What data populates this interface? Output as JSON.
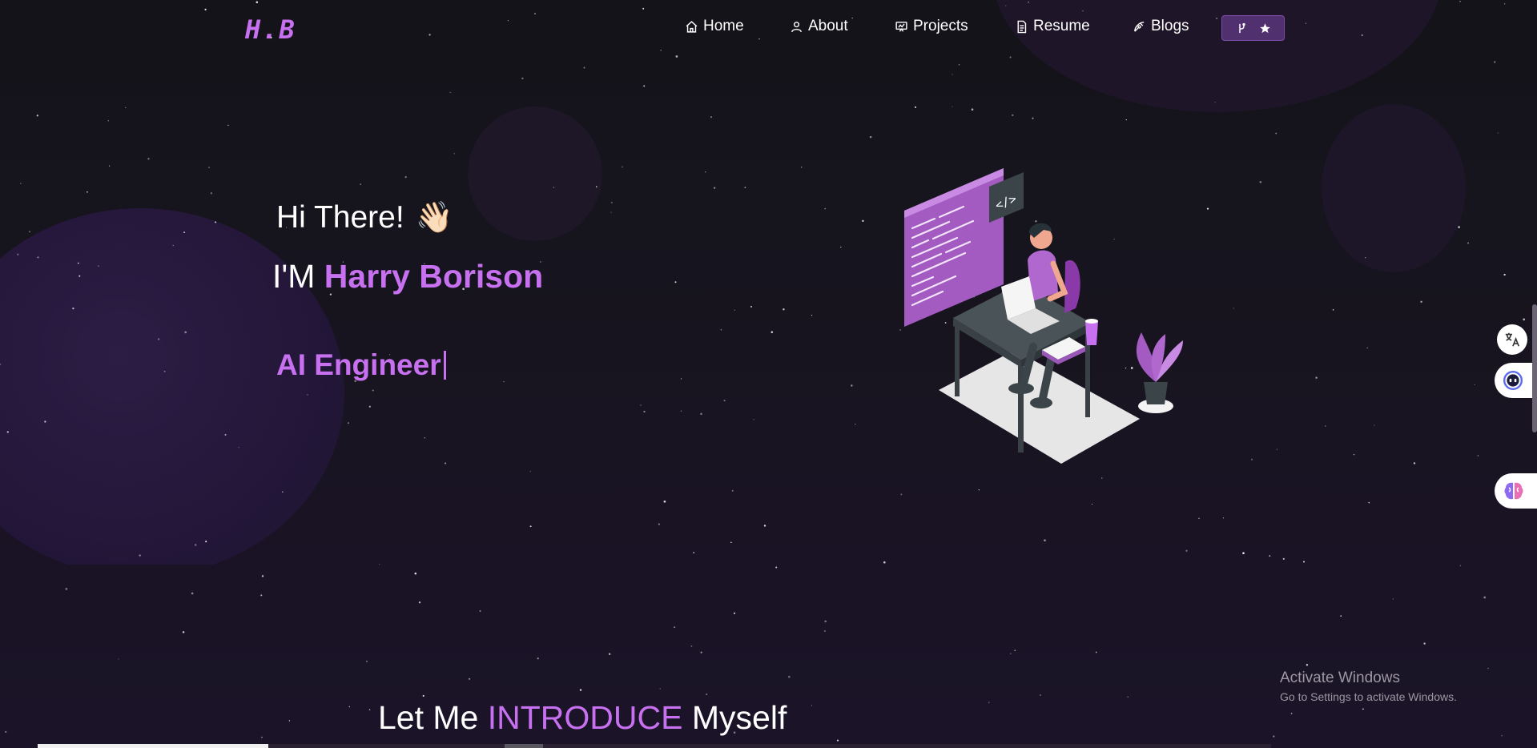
{
  "nav": {
    "logo": "H.B",
    "items": [
      {
        "label": "Home",
        "icon": "home-icon"
      },
      {
        "label": "About",
        "icon": "user-icon"
      },
      {
        "label": "Projects",
        "icon": "projects-icon"
      },
      {
        "label": "Resume",
        "icon": "document-icon"
      },
      {
        "label": "Blogs",
        "icon": "blog-icon"
      }
    ],
    "github_icons": [
      "fork-icon",
      "star-icon"
    ]
  },
  "hero": {
    "greeting": "Hi There!",
    "greeting_emoji": "👋🏻",
    "name_prefix": "I'M",
    "name": "Harry Borison",
    "typed_role": "AI Engineer"
  },
  "intro": {
    "prefix": "Let Me",
    "accent": "INTRODUCE",
    "suffix": "Myself"
  },
  "side_widgets": [
    "translate-icon",
    "assistant-icon",
    "brain-icon"
  ],
  "os_watermark": {
    "title": "Activate Windows",
    "subtitle": "Go to Settings to activate Windows."
  },
  "colors": {
    "accent": "#c770f0",
    "background": "#141319",
    "button": "#50306e"
  }
}
